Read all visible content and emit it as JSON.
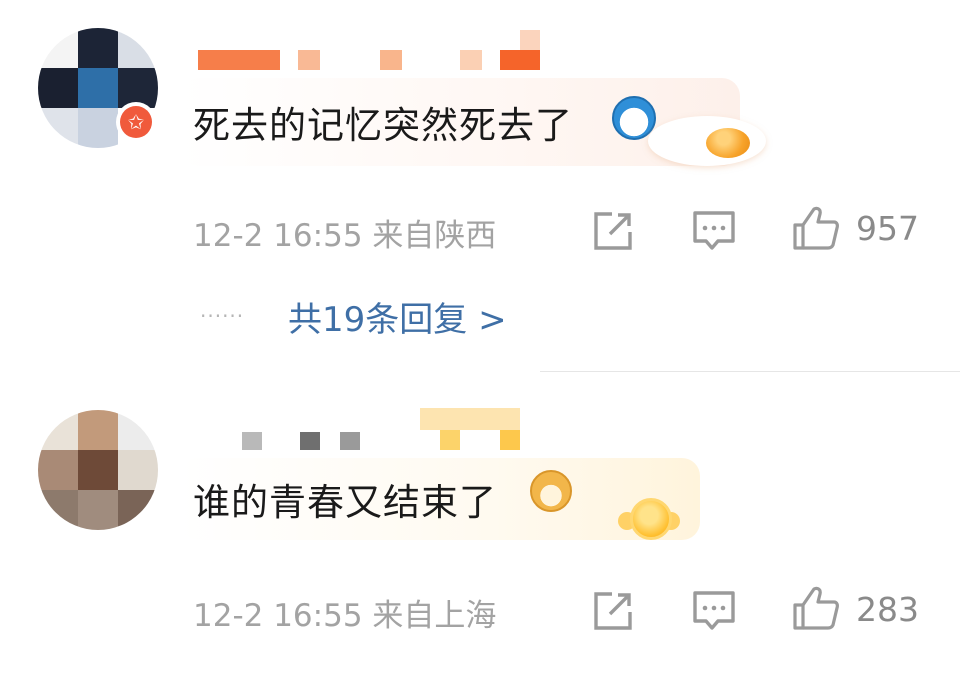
{
  "comments": [
    {
      "text": "死去的记忆突然死去了",
      "meta": "12-2 16:55 来自陕西",
      "likes": "957",
      "replies": {
        "dots": "······",
        "label": "共19条回复 >"
      },
      "icons": [
        "avatar-badge-icon",
        "doraemon-emoji-icon",
        "fried-egg-icon",
        "share-icon",
        "comment-icon",
        "thumbs-up-icon"
      ]
    },
    {
      "text": "谁的青春又结束了",
      "meta": "12-2 16:55 来自上海",
      "likes": "283",
      "icons": [
        "doge-emoji-icon",
        "gold-medal-icon",
        "share-icon",
        "comment-icon",
        "thumbs-up-icon"
      ]
    }
  ],
  "colors": {
    "reply_link": "#3f6fa6",
    "meta_text": "#a3a3a3",
    "badge": "#f05a3c"
  }
}
